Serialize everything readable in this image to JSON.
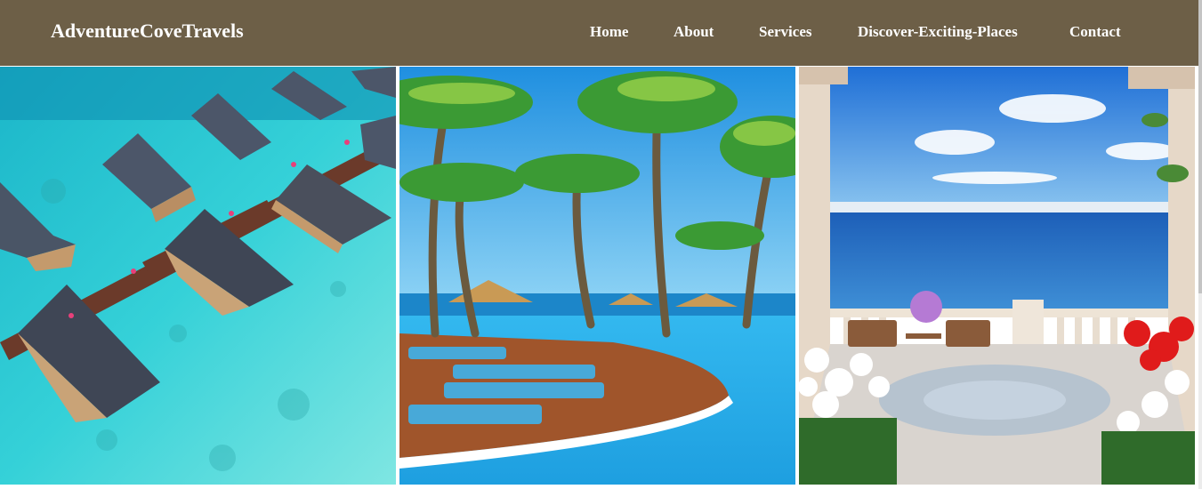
{
  "brand": {
    "name": "AdventureCoveTravels"
  },
  "nav": {
    "items": [
      {
        "label": "Home"
      },
      {
        "label": "About"
      },
      {
        "label": "Services"
      },
      {
        "label": "Discover-Exciting-Places"
      },
      {
        "label": "Contact"
      }
    ]
  },
  "gallery": {
    "images": [
      {
        "subject": "overwater-bungalows-lagoon"
      },
      {
        "subject": "palm-tree-resort-pool"
      },
      {
        "subject": "seaside-terrace-balcony"
      }
    ]
  },
  "colors": {
    "navbar": "#6d5f47",
    "nav_text": "#ffffff"
  }
}
